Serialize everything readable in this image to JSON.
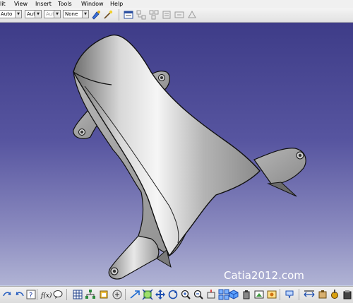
{
  "menubar": {
    "items": [
      {
        "label": "lit"
      },
      {
        "label": "View"
      },
      {
        "label": "Insert"
      },
      {
        "label": "Tools"
      },
      {
        "label": "Window"
      },
      {
        "label": "Help"
      }
    ]
  },
  "toolbar": {
    "color_combo": "Auto",
    "linetype_combo": "Aut",
    "thickness_combo": "Aut",
    "layer_combo": "None"
  },
  "viewport": {
    "watermark": "Catia2012.com",
    "colors": {
      "bg_top": "#3e3c88",
      "bg_bottom": "#b0b3d4",
      "part": "#a8a8a8"
    }
  }
}
